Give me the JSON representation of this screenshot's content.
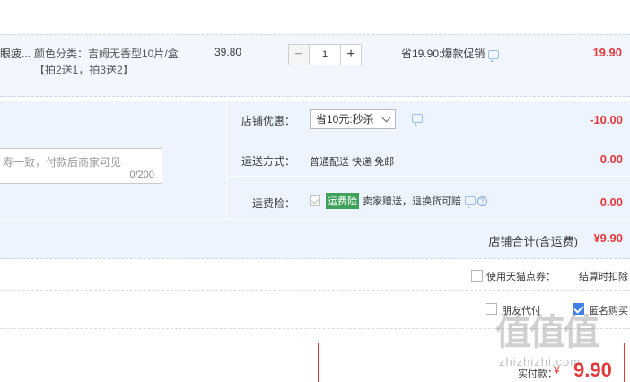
{
  "item": {
    "title": "眼疲...",
    "sku": "颜色分类：吉姆无香型10片/盒",
    "promo": "【拍2送1，拍3送2】",
    "unit_price": "39.80",
    "quantity": "1",
    "minus": "−",
    "plus": "+",
    "saving": "省19.90:爆款促销",
    "total": "19.90"
  },
  "message": {
    "placeholder": "寿一致，付款后商家可见",
    "counter": "0/200"
  },
  "summary": {
    "coupon_label": "店铺优惠：",
    "coupon_selected": "省10元:秒杀",
    "coupon_amount": "-10.00",
    "shipping_label": "运送方式：",
    "shipping_value": "普通配送 快递 免邮",
    "shipping_amount": "0.00",
    "insurance_label": "运费险：",
    "insurance_tag": "运费险",
    "insurance_desc": "卖家赠送，退换货可赔",
    "insurance_help": "?",
    "insurance_amount": "0.00",
    "shop_total_label": "店铺合计(含运费)",
    "shop_total_value": "¥9.90"
  },
  "points": {
    "label": "使用天猫点券：",
    "desc": "结算时扣除"
  },
  "options": {
    "friend_pay": "朋友代付",
    "anonymous": "匿名购买",
    "anonymous_checked": true
  },
  "payment": {
    "label": "实付款：",
    "currency": "¥",
    "value": "9.90"
  },
  "watermark": {
    "glyphs": "值值值",
    "text": "zhizhizhi.com"
  }
}
